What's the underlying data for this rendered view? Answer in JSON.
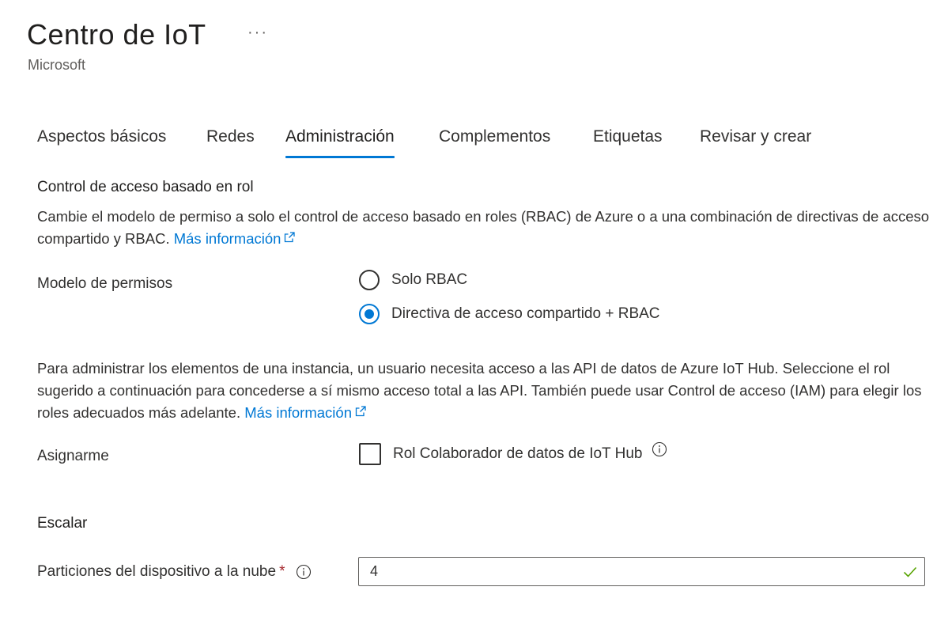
{
  "header": {
    "title": "Centro de IoT",
    "more": "···",
    "subtitle": "Microsoft"
  },
  "tabs": [
    {
      "label": "Aspectos básicos",
      "active": false
    },
    {
      "label": "Redes",
      "active": false
    },
    {
      "label": "Administración",
      "active": true
    },
    {
      "label": "Complementos",
      "active": false
    },
    {
      "label": "Etiquetas",
      "active": false
    },
    {
      "label": "Revisar y crear",
      "active": false
    }
  ],
  "rbac": {
    "heading": "Control de acceso basado en rol",
    "description": "Cambie el modelo de permiso a solo el control de acceso basado en roles (RBAC) de Azure o a una combinación de directivas de acceso compartido y RBAC.",
    "link": "Más información",
    "permissions_label": "Modelo de permisos",
    "options": [
      {
        "label": "Solo RBAC",
        "selected": false
      },
      {
        "label": "Directiva de acceso compartido + RBAC",
        "selected": true
      }
    ]
  },
  "data_access": {
    "description": "Para administrar los elementos de una instancia, un usuario necesita acceso a las API de datos de Azure IoT Hub. Seleccione el rol sugerido a continuación para concederse a sí mismo acceso total a las API. También puede usar Control de acceso (IAM) para elegir los roles adecuados más adelante.",
    "link": "Más información",
    "assign_label": "Asignarme",
    "checkbox_label": "Rol Colaborador de datos de IoT Hub",
    "checked": false
  },
  "scale": {
    "heading": "Escalar",
    "partitions_label": "Particiones del dispositivo a la nube",
    "required_mark": "*",
    "partitions_value": "4"
  },
  "colors": {
    "accent": "#0078d4",
    "required": "#a4262c",
    "valid": "#57a300"
  },
  "icons": {
    "more": "more-icon",
    "external_link": "external-link-icon",
    "info": "info-icon",
    "valid": "checkmark-icon"
  }
}
